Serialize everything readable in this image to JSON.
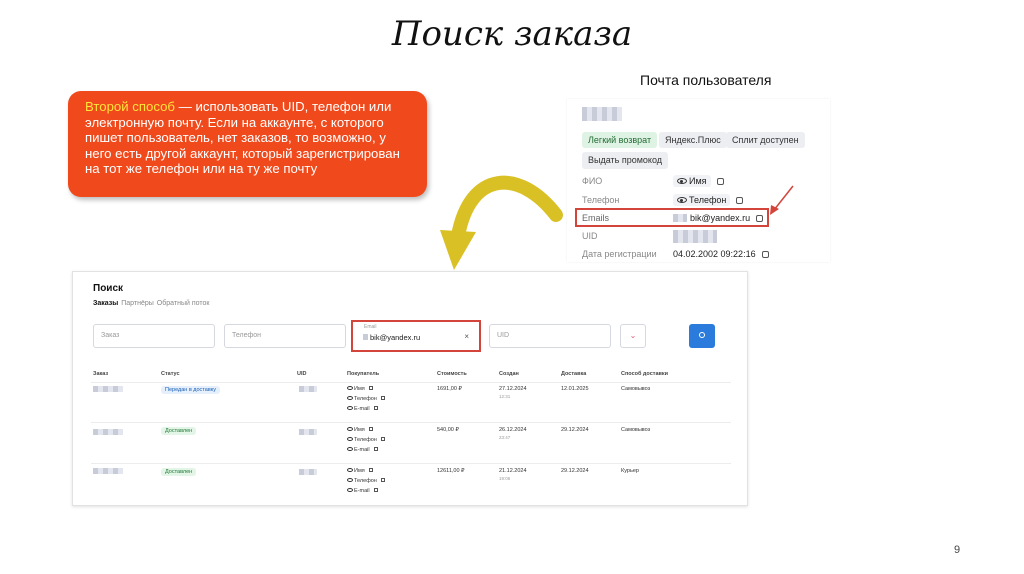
{
  "slide": {
    "title": "Поиск заказа",
    "page_number": "9"
  },
  "callout": {
    "highlight": "Второй способ",
    "text": " — использовать UID, телефон или электронную почту. Если на аккаунте, с которого пишет пользователь, нет заказов, то возможно, у него есть другой аккаунт, который зарегистрирован на тот же телефон или на ту же почту"
  },
  "profile_caption": "Почта пользователя",
  "profile": {
    "tags": [
      "Легкий возврат",
      "Яндекс.Плюс",
      "Сплит доступен"
    ],
    "promo_button": "Выдать промокод",
    "fields": [
      {
        "label": "ФИО",
        "value": "Имя"
      },
      {
        "label": "Телефон",
        "value": "Телефон"
      },
      {
        "label": "Emails",
        "value": "bik@yandex.ru"
      },
      {
        "label": "UID",
        "value": ""
      },
      {
        "label": "Дата регистрации",
        "value": "04.02.2002 09:22:16"
      }
    ]
  },
  "search": {
    "title": "Поиск",
    "tabs": [
      "Заказы",
      "Партнёры",
      "Обратный поток"
    ],
    "fields": {
      "order": "Заказ",
      "phone": "Телефон",
      "email_label": "Email",
      "email_value": "bik@yandex.ru",
      "uid": "UID"
    },
    "columns": [
      "Заказ",
      "Статус",
      "UID",
      "Покупатель",
      "Стоимость",
      "Создан",
      "Доставка",
      "Способ доставки"
    ],
    "buyer_items": [
      "Имя",
      "Телефон",
      "E-mail"
    ],
    "rows": [
      {
        "status": "Передан в доставку",
        "status_color": "blue",
        "cost": "1691,00 ₽",
        "created": "27.12.2024",
        "created_time": "12:31",
        "delivery": "12.01.2025",
        "method": "Самовывоз"
      },
      {
        "status": "Доставлен",
        "status_color": "green",
        "cost": "540,00 ₽",
        "created": "26.12.2024",
        "created_time": "23:47",
        "delivery": "29.12.2024",
        "method": "Самовывоз"
      },
      {
        "status": "Доставлен",
        "status_color": "green",
        "cost": "12611,00 ₽",
        "created": "21.12.2024",
        "created_time": "19:06",
        "delivery": "29.12.2024",
        "method": "Курьер"
      }
    ]
  },
  "colors": {
    "callout_bg": "#f04a1c",
    "highlight": "#ffe43a",
    "red_outline": "#d3443b",
    "yellow_arrow": "#d9c125",
    "search_button": "#2a7bdc"
  }
}
